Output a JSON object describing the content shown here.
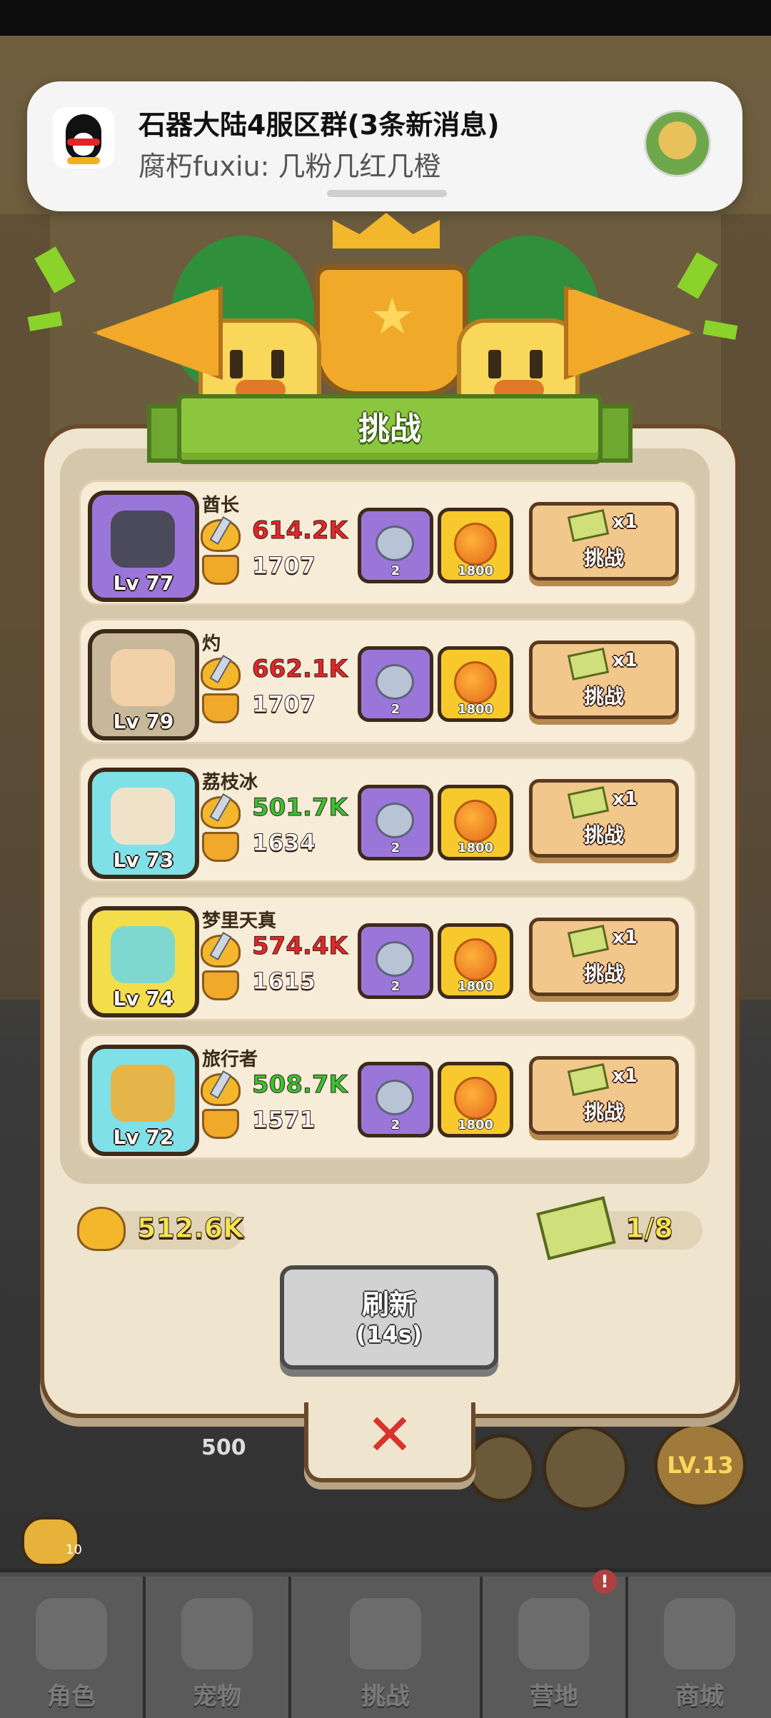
{
  "notification": {
    "title": "石器大陆4服区群(3条新消息)",
    "message": "腐朽fuxiu: 几粉几红几橙"
  },
  "panel": {
    "title": "挑战",
    "opponents": [
      {
        "name": "酋长",
        "level": "Lv 77",
        "power": "614.2K",
        "power_color": "#e3262b",
        "trophies": "1707",
        "reward_stone": "2",
        "reward_coin": "1800",
        "ticket_cost": "x1",
        "button": "挑战",
        "frame": "#9b76d9"
      },
      {
        "name": "灼",
        "level": "Lv 79",
        "power": "662.1K",
        "power_color": "#e3262b",
        "trophies": "1707",
        "reward_stone": "2",
        "reward_coin": "1800",
        "ticket_cost": "x1",
        "button": "挑战",
        "frame": "#c8b89a"
      },
      {
        "name": "荔枝冰",
        "level": "Lv 73",
        "power": "501.7K",
        "power_color": "#38c234",
        "trophies": "1634",
        "reward_stone": "2",
        "reward_coin": "1800",
        "ticket_cost": "x1",
        "button": "挑战",
        "frame": "#7fe0e8"
      },
      {
        "name": "梦里天真",
        "level": "Lv 74",
        "power": "574.4K",
        "power_color": "#e3262b",
        "trophies": "1615",
        "reward_stone": "2",
        "reward_coin": "1800",
        "ticket_cost": "x1",
        "button": "挑战",
        "frame": "#f4dd4a"
      },
      {
        "name": "旅行者",
        "level": "Lv 72",
        "power": "508.7K",
        "power_color": "#38c234",
        "trophies": "1571",
        "reward_stone": "2",
        "reward_coin": "1800",
        "ticket_cost": "x1",
        "button": "挑战",
        "frame": "#7fe0e8"
      }
    ],
    "my_power": "512.6K",
    "tickets": "1/8",
    "refresh_label": "刷新",
    "refresh_timer": "(14s)"
  },
  "background": {
    "level_badge": "LV.13",
    "gem_count": "500",
    "chat_count": "10"
  },
  "bottom_nav": [
    {
      "label": "角色"
    },
    {
      "label": "宠物"
    },
    {
      "label": "挑战"
    },
    {
      "label": "营地",
      "badge": "!"
    },
    {
      "label": "商城"
    }
  ]
}
